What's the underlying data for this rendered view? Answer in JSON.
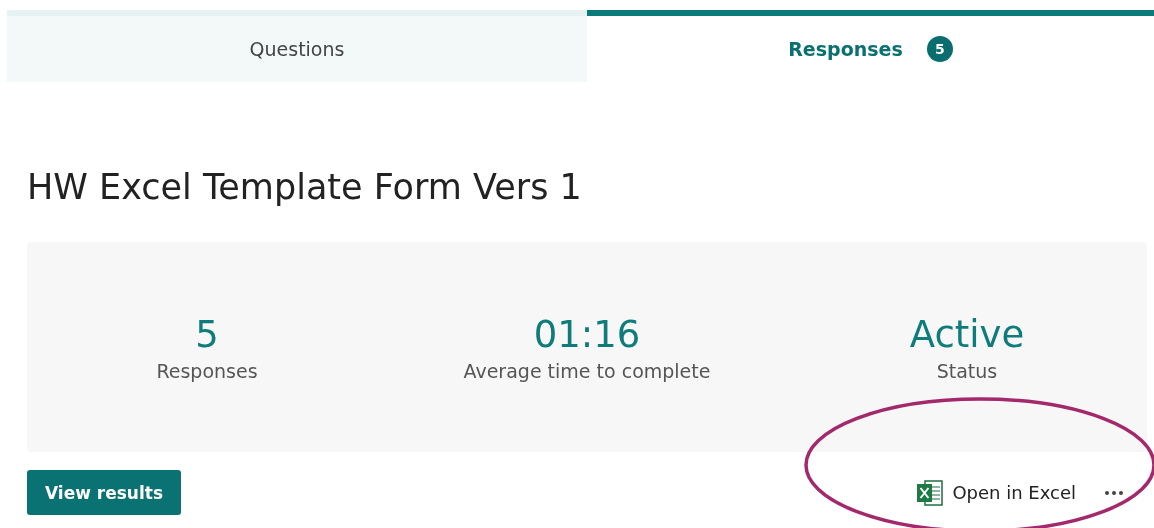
{
  "tabs": [
    {
      "label": "Questions",
      "selected": false
    },
    {
      "label": "Responses",
      "selected": true,
      "badge": "5"
    }
  ],
  "form_title": "HW Excel Template Form Vers 1",
  "summary": [
    {
      "value": "5",
      "label": "Responses"
    },
    {
      "value": "01:16",
      "label": "Average time to complete"
    },
    {
      "value": "Active",
      "label": "Status"
    }
  ],
  "view_results_button": "View results",
  "open_in_excel": "Open in Excel"
}
